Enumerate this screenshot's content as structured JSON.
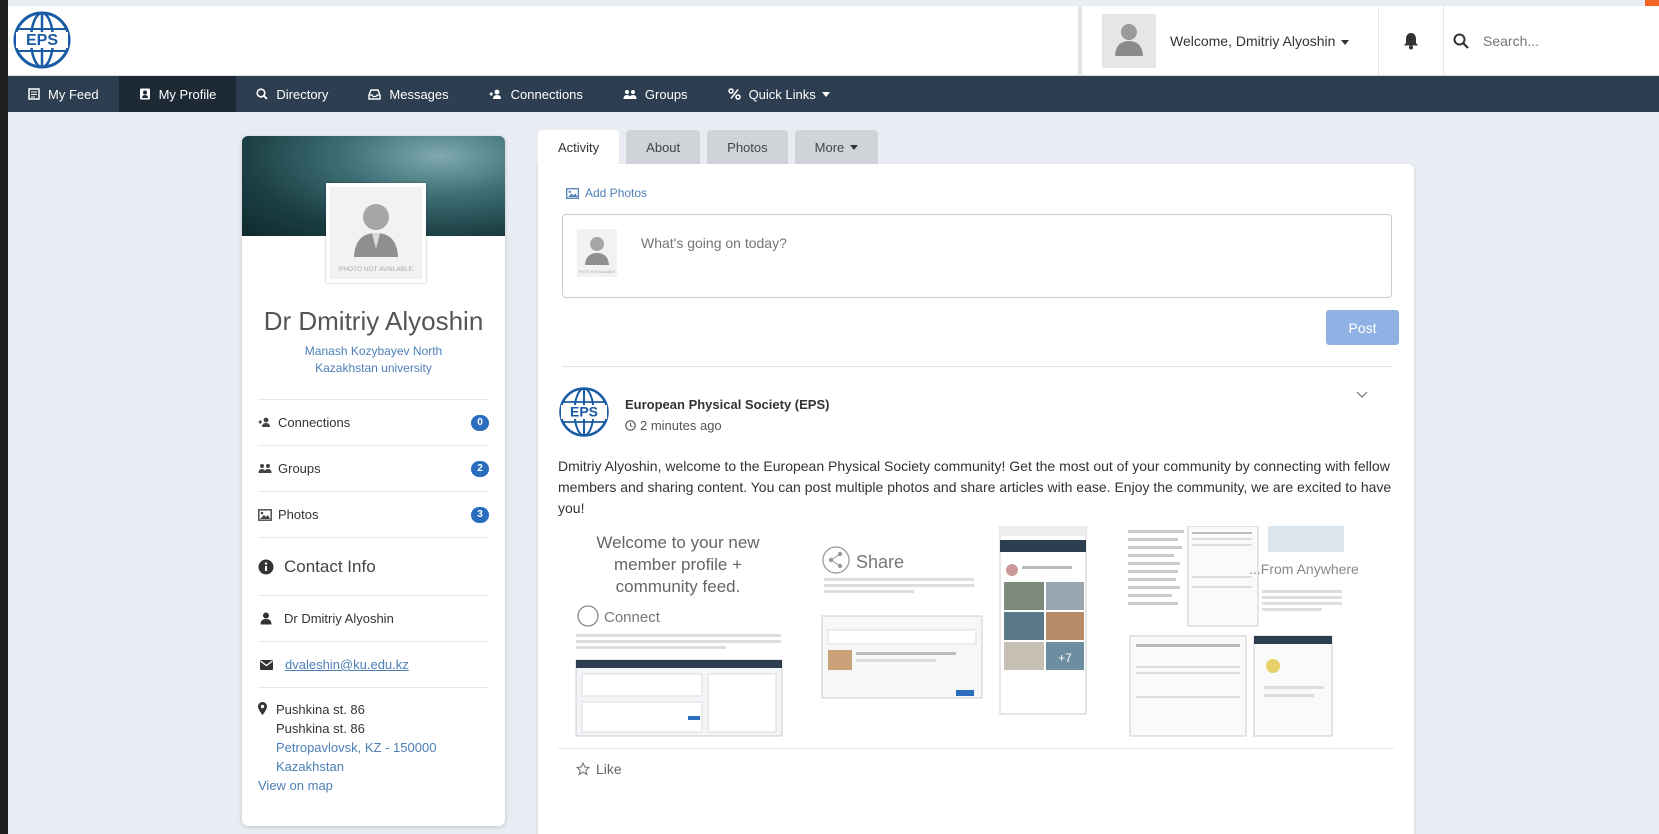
{
  "header": {
    "logo_text": "EPS",
    "welcome": "Welcome, Dmitriy Alyoshin",
    "search_placeholder": "Search..."
  },
  "nav": {
    "items": [
      {
        "label": "My Feed",
        "icon": "feed-icon"
      },
      {
        "label": "My Profile",
        "icon": "profile-icon"
      },
      {
        "label": "Directory",
        "icon": "search-icon"
      },
      {
        "label": "Messages",
        "icon": "inbox-icon"
      },
      {
        "label": "Connections",
        "icon": "connections-icon"
      },
      {
        "label": "Groups",
        "icon": "groups-icon"
      },
      {
        "label": "Quick Links",
        "icon": "link-icon"
      }
    ],
    "active": "My Profile"
  },
  "profile": {
    "photo_placeholder": "PHOTO NOT AVAILABLE",
    "name": "Dr Dmitriy Alyoshin",
    "organization": "Manash Kozybayev North Kazakhstan university",
    "stats": [
      {
        "label": "Connections",
        "count": "0"
      },
      {
        "label": "Groups",
        "count": "2"
      },
      {
        "label": "Photos",
        "count": "3"
      }
    ],
    "contact_title": "Contact Info",
    "contact_name": "Dr Dmitriy Alyoshin",
    "email": "dvaleshin@ku.edu.kz",
    "address_line1": "Pushkina st. 86",
    "address_line2": "Pushkina st. 86",
    "address_city": "Petropavlovsk, KZ - 150000",
    "address_country": "Kazakhstan",
    "map_link": "View on map"
  },
  "tabs": [
    {
      "label": "Activity"
    },
    {
      "label": "About"
    },
    {
      "label": "Photos"
    },
    {
      "label": "More"
    }
  ],
  "composer": {
    "add_photos": "Add Photos",
    "placeholder": "What's going on today?",
    "post_label": "Post"
  },
  "feed": {
    "author": "European Physical Society (EPS)",
    "time": "2 minutes ago",
    "text": "Dmitriy Alyoshin, welcome to the European Physical Society community! Get the most out of your community by connecting with fellow members and sharing content. You can post multiple photos and share articles with ease. Enjoy the community, we are excited to have you!",
    "image1_title": "Welcome to your new member profile + community feed.",
    "image1_connect": "Connect",
    "image2_title": "Share",
    "image3_title": "...From Anywhere",
    "like_label": "Like"
  },
  "colors": {
    "nav_bg": "#2c3e50",
    "accent": "#2a6ebd",
    "link": "#4d7fb6",
    "post_button": "#8fb1e3"
  }
}
